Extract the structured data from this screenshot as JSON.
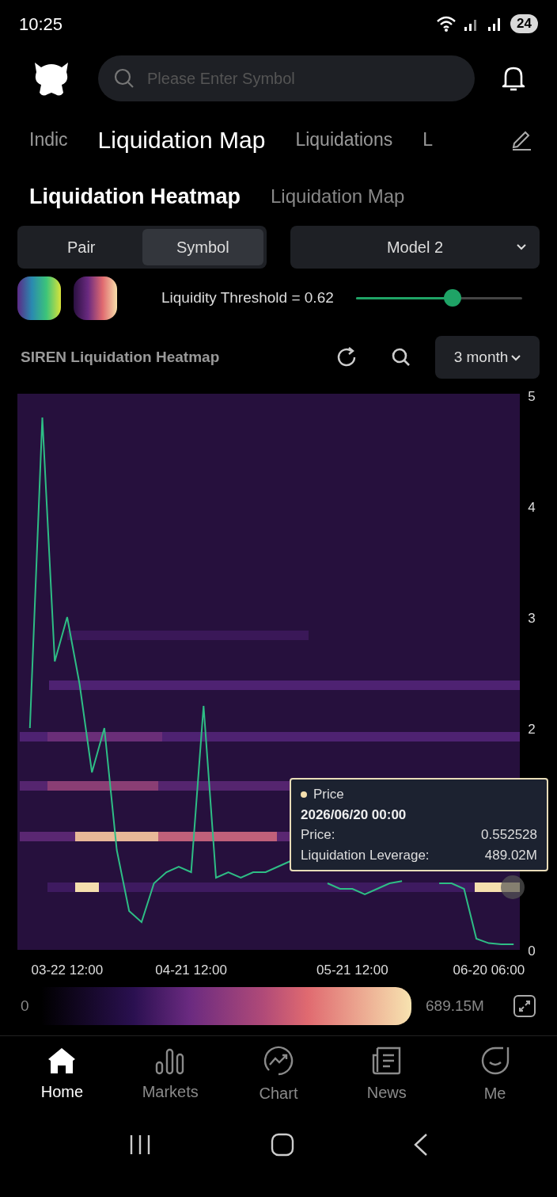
{
  "status_bar": {
    "time": "10:25",
    "battery": "24"
  },
  "search": {
    "placeholder": "Please Enter Symbol"
  },
  "top_tabs": [
    {
      "label": "Indic",
      "selected": false
    },
    {
      "label": "Liquidation Map",
      "selected": true
    },
    {
      "label": "Liquidations",
      "selected": false
    },
    {
      "label": "L",
      "selected": false
    }
  ],
  "sub_tabs": [
    {
      "label": "Liquidation Heatmap",
      "selected": true
    },
    {
      "label": "Liquidation Map",
      "selected": false
    }
  ],
  "segments": [
    {
      "label": "Pair",
      "selected": false
    },
    {
      "label": "Symbol",
      "selected": true
    }
  ],
  "model_select": {
    "value": "Model 2"
  },
  "threshold": {
    "label": "Liquidity Threshold = 0.62",
    "level": 0.58
  },
  "chart_title": "SIREN Liquidation Heatmap",
  "period_select": {
    "value": "3 month"
  },
  "chart_data": {
    "type": "line",
    "ylim": [
      0,
      5
    ],
    "yticks": [
      0,
      2,
      3,
      4,
      5
    ],
    "categories": [
      null,
      null,
      null,
      "03-22 12:00",
      null,
      null,
      null,
      null,
      null,
      null,
      null,
      null,
      null,
      "04-21 12:00",
      null,
      null,
      null,
      null,
      null,
      null,
      null,
      null,
      null,
      null,
      null,
      null,
      "05-21 12:00",
      null,
      null,
      null,
      null,
      null,
      null,
      null,
      null,
      null,
      null,
      "06-20 06:00",
      null,
      null
    ],
    "series": [
      {
        "name": "Price",
        "color": "#2ebd85",
        "values": [
          2.0,
          4.8,
          2.6,
          3.0,
          2.4,
          1.6,
          2.0,
          0.9,
          0.35,
          0.25,
          0.6,
          0.7,
          0.75,
          0.7,
          2.2,
          0.65,
          0.7,
          0.65,
          0.7,
          0.7,
          0.75,
          0.8,
          null,
          null,
          0.6,
          0.55,
          0.55,
          0.5,
          0.55,
          0.6,
          0.62,
          null,
          null,
          0.6,
          0.6,
          0.55,
          0.1,
          0.06,
          0.05,
          0.05
        ]
      }
    ]
  },
  "tooltip": {
    "date": "2026/06/20 00:00",
    "rows": [
      {
        "label": "Price:",
        "value": "0.552528"
      },
      {
        "label": "Liquidation Leverage:",
        "value": "489.02M"
      }
    ]
  },
  "legend": {
    "min": "0",
    "max": "689.15M"
  },
  "bottom_nav": [
    {
      "label": "Home",
      "kind": "home",
      "selected": true
    },
    {
      "label": "Markets",
      "kind": "markets",
      "selected": false
    },
    {
      "label": "Chart",
      "kind": "chart",
      "selected": false
    },
    {
      "label": "News",
      "kind": "news",
      "selected": false
    },
    {
      "label": "Me",
      "kind": "me",
      "selected": false
    }
  ]
}
